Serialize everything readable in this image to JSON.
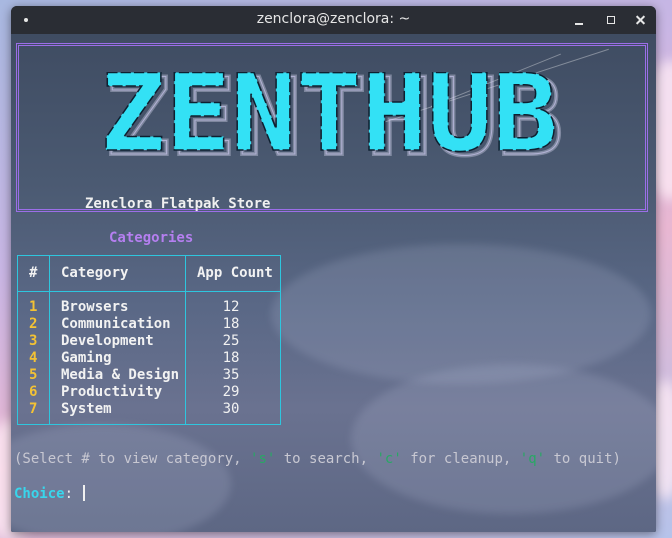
{
  "window": {
    "title": "zenclora@zenclora: ~"
  },
  "banner": {
    "logo_text": "ZENTHUB",
    "subtitle": "Zenclora Flatpak Store",
    "border_color": "#9b6ee8",
    "logo_color": "#33e1f5"
  },
  "categories": {
    "heading": "Categories",
    "columns": {
      "num": "#",
      "category": "Category",
      "count": "App Count"
    },
    "rows": [
      {
        "num": "1",
        "name": "Browsers",
        "count": "12"
      },
      {
        "num": "2",
        "name": "Communication",
        "count": "18"
      },
      {
        "num": "3",
        "name": "Development",
        "count": "25"
      },
      {
        "num": "4",
        "name": "Gaming",
        "count": "18"
      },
      {
        "num": "5",
        "name": "Media & Design",
        "count": "35"
      },
      {
        "num": "6",
        "name": "Productivity",
        "count": "29"
      },
      {
        "num": "7",
        "name": "System",
        "count": "30"
      }
    ]
  },
  "help": {
    "p1": "(Select # to view category, ",
    "k1": "'s'",
    "p2": " to search, ",
    "k2": "'c'",
    "p3": " for cleanup, ",
    "k3": "'q'",
    "p4": " to quit)"
  },
  "prompt": {
    "label": "Choice",
    "suffix": ": "
  },
  "colors": {
    "accent_cyan": "#2ec6de",
    "number_yellow": "#f3c234",
    "heading_purple": "#b57ff0",
    "key_green": "#28a865"
  }
}
